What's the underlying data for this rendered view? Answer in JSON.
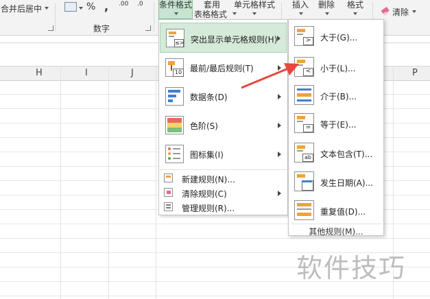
{
  "ribbon": {
    "merge_center": "合并后居中",
    "number_group": "数字",
    "percent_symbol": "%",
    "comma_symbol": ",",
    "inc_decimal": ".00",
    "dec_decimal": ".0",
    "conditional_format": "条件格式",
    "table_format_top": "套用",
    "table_format_bottom": "表格格式",
    "cell_style": "单元格样式",
    "insert": "插入",
    "delete": "删除",
    "format": "格式",
    "clear": "清除"
  },
  "columns": [
    "H",
    "I",
    "J",
    "P"
  ],
  "menu": {
    "items": [
      {
        "label": "突出显示单元格规则(H)"
      },
      {
        "label": "最前/最后规则(T)",
        "icon_text": "10"
      },
      {
        "label": "数据条(D)"
      },
      {
        "label": "色阶(S)"
      },
      {
        "label": "图标集(I)"
      }
    ],
    "small_items": [
      {
        "label": "新建规则(N)..."
      },
      {
        "label": "清除规则(C)"
      },
      {
        "label": "管理规则(R)..."
      }
    ]
  },
  "submenu": {
    "items": [
      {
        "label": "大于(G)...",
        "icon_sym": ">"
      },
      {
        "label": "小于(L)...",
        "icon_sym": "<"
      },
      {
        "label": "介于(B)..."
      },
      {
        "label": "等于(E)...",
        "icon_sym": "="
      },
      {
        "label": "文本包含(T)...",
        "icon_sym": "ab"
      },
      {
        "label": "发生日期(A)..."
      },
      {
        "label": "重复值(D)..."
      }
    ],
    "footer": "其他规则(M)..."
  },
  "highlight_icon_sym": "≤>",
  "watermark": "软件技巧",
  "colors": {
    "accent_green": "#d5ead9",
    "arrow_red": "#e8473f",
    "bar_blue": "#3e7fd0",
    "bar_orange": "#f0a33a"
  }
}
